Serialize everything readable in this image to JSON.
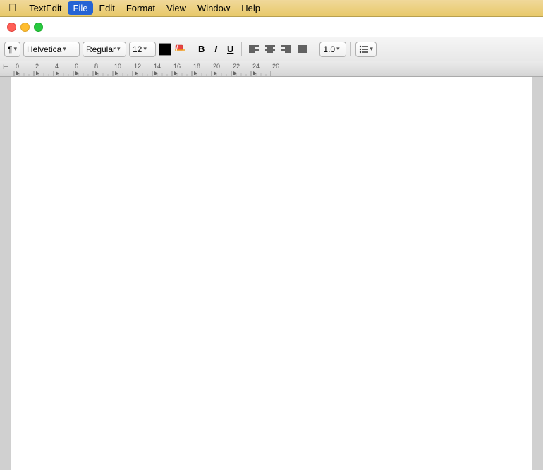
{
  "menubar": {
    "apple_label": "",
    "items": [
      {
        "id": "textedit",
        "label": "TextEdit",
        "active": false
      },
      {
        "id": "file",
        "label": "File",
        "active": true
      },
      {
        "id": "edit",
        "label": "Edit",
        "active": false
      },
      {
        "id": "format",
        "label": "Format",
        "active": false
      },
      {
        "id": "view",
        "label": "View",
        "active": false
      },
      {
        "id": "window",
        "label": "Window",
        "active": false
      },
      {
        "id": "help",
        "label": "Help",
        "active": false
      }
    ]
  },
  "toolbar": {
    "paragraph_style": "¶",
    "paragraph_style_arrow": "▾",
    "font_name": "Helvetica",
    "font_style": "Regular",
    "font_style_arrow": "▾",
    "font_size": "12",
    "font_size_arrow": "▾",
    "bold_label": "B",
    "italic_label": "I",
    "underline_label": "U",
    "align_left": "≡",
    "align_center": "≡",
    "align_right": "≡",
    "align_justify": "≡",
    "line_spacing": "1.0",
    "line_spacing_arrow": "▾",
    "list_icon": "≡",
    "list_arrow": "▾"
  },
  "ruler": {
    "tab_icon": "⊢",
    "marks": [
      0,
      2,
      4,
      6,
      8,
      10,
      12,
      14,
      16,
      18,
      20,
      22,
      24,
      26
    ]
  },
  "document": {
    "cursor_visible": true
  }
}
